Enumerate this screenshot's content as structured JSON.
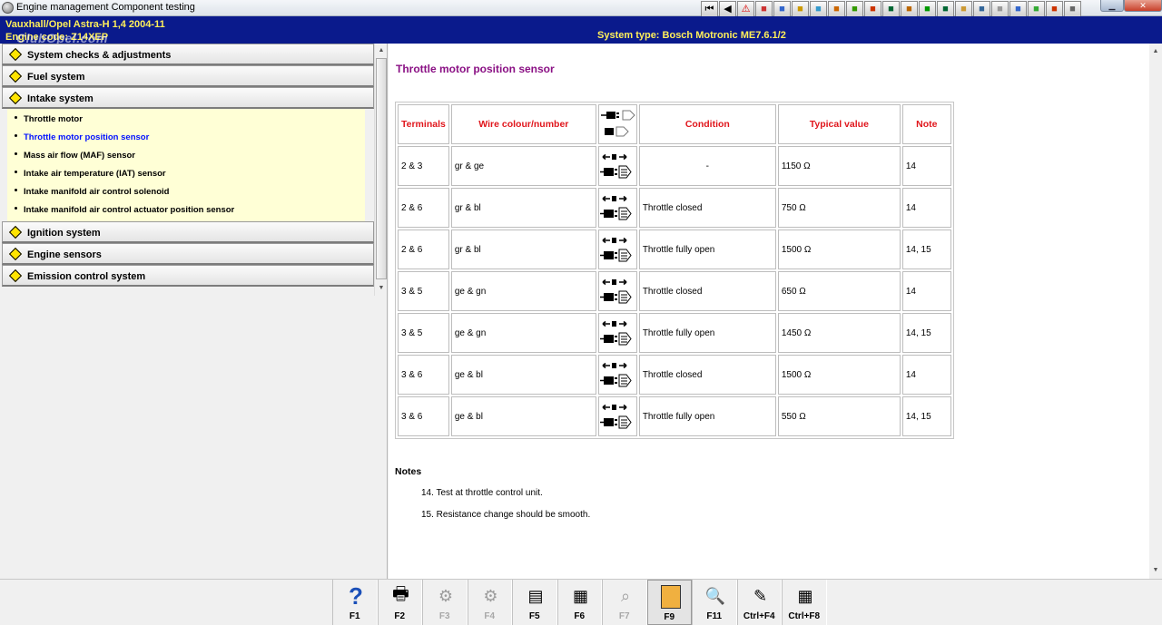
{
  "window": {
    "title": "Engine management Component testing",
    "toolbar_icons": [
      "first-icon",
      "prev-icon",
      "warning-icon",
      "tool-icon-1",
      "tool-icon-2",
      "tool-icon-3",
      "tool-icon-4",
      "tool-icon-5",
      "tool-icon-6",
      "tool-icon-7",
      "tool-icon-8",
      "tool-icon-9",
      "tool-icon-10",
      "tool-icon-11",
      "tool-icon-12",
      "tool-icon-13",
      "tool-icon-14",
      "tool-icon-15",
      "tool-icon-16",
      "tool-icon-17",
      "tool-icon-18"
    ]
  },
  "header": {
    "vehicle": "Vauxhall/Opel   Astra-H  1,4  2004-11",
    "engine": "Engine code: Z14XEP",
    "system": "System type: Bosch Motronic ME7.6.1/2",
    "watermark": "ClubOpel.com"
  },
  "nav": {
    "sections": [
      {
        "label": "System checks & adjustments"
      },
      {
        "label": "Fuel system"
      },
      {
        "label": "Intake system",
        "expanded": true,
        "items": [
          {
            "label": "Throttle motor"
          },
          {
            "label": "Throttle motor position sensor",
            "active": true
          },
          {
            "label": "Mass air flow (MAF) sensor"
          },
          {
            "label": "Intake air temperature (IAT) sensor"
          },
          {
            "label": "Intake manifold air control solenoid"
          },
          {
            "label": "Intake manifold air control actuator position sensor"
          }
        ]
      },
      {
        "label": "Ignition system"
      },
      {
        "label": "Engine sensors"
      },
      {
        "label": "Emission control system"
      }
    ]
  },
  "main": {
    "title": "Throttle motor position sensor",
    "table": {
      "headers": {
        "terminals": "Terminals",
        "wire": "Wire colour/number",
        "condition": "Condition",
        "typical": "Typical value",
        "note": "Note"
      },
      "rows": [
        {
          "terminals": "2 & 3",
          "wire": "gr & ge",
          "condition": "-",
          "typical": "1150 Ω",
          "note": "14"
        },
        {
          "terminals": "2 & 6",
          "wire": "gr & bl",
          "condition": "Throttle closed",
          "typical": "750 Ω",
          "note": "14"
        },
        {
          "terminals": "2 & 6",
          "wire": "gr & bl",
          "condition": "Throttle fully open",
          "typical": "1500 Ω",
          "note": "14, 15"
        },
        {
          "terminals": "3 & 5",
          "wire": "ge & gn",
          "condition": "Throttle closed",
          "typical": "650 Ω",
          "note": "14"
        },
        {
          "terminals": "3 & 5",
          "wire": "ge & gn",
          "condition": "Throttle fully open",
          "typical": "1450 Ω",
          "note": "14, 15"
        },
        {
          "terminals": "3 & 6",
          "wire": "ge & bl",
          "condition": "Throttle closed",
          "typical": "1500 Ω",
          "note": "14"
        },
        {
          "terminals": "3 & 6",
          "wire": "ge & bl",
          "condition": "Throttle fully open",
          "typical": "550 Ω",
          "note": "14, 15"
        }
      ]
    },
    "notes": {
      "title": "Notes",
      "items": [
        "14. Test at throttle control unit.",
        "15. Resistance change should be smooth."
      ]
    }
  },
  "fkeys": [
    {
      "label": "F1",
      "icon": "help-icon"
    },
    {
      "label": "F2",
      "icon": "print-icon"
    },
    {
      "label": "F3",
      "icon": "tool-icon",
      "disabled": true
    },
    {
      "label": "F4",
      "icon": "tool-icon",
      "disabled": true
    },
    {
      "label": "F5",
      "icon": "diagram-icon"
    },
    {
      "label": "F6",
      "icon": "connector-icon"
    },
    {
      "label": "F7",
      "icon": "probe-icon",
      "disabled": true
    },
    {
      "label": "F9",
      "icon": "component-icon",
      "pressed": true
    },
    {
      "label": "F11",
      "icon": "search-icon"
    },
    {
      "label": "Ctrl+F4",
      "icon": "notes-icon"
    },
    {
      "label": "Ctrl+F8",
      "icon": "table-icon"
    }
  ]
}
